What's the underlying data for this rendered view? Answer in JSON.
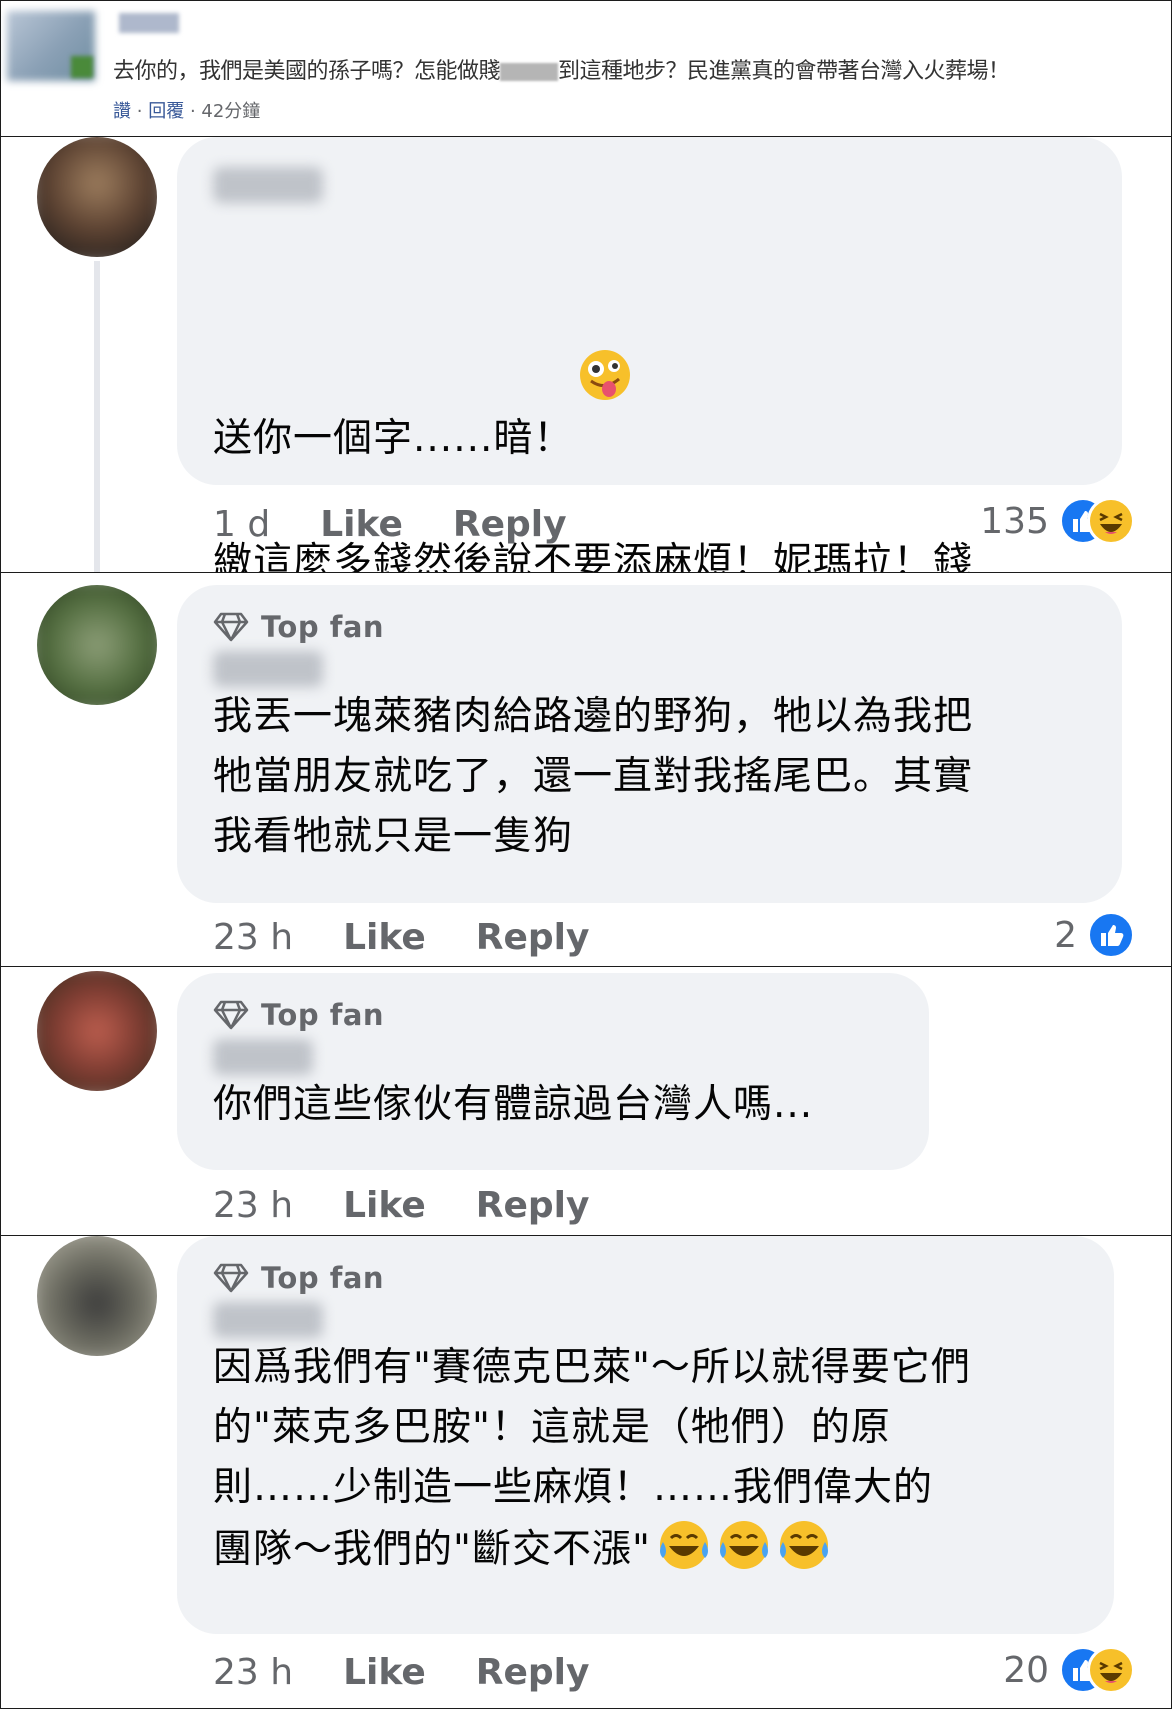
{
  "snippet": {
    "text_before": "去你的，我們是美國的孫子嗎？怎能做賤",
    "text_after": "到這種地步？民進黨真的會帶著台灣入火葬場！",
    "meta_report": "讚",
    "meta_sep": "·",
    "meta_reply": "回覆",
    "meta_time": "· 42分鐘"
  },
  "comments": [
    {
      "top_fan": "",
      "line1": "送你一個字......暗！",
      "body": "繳這麼多錢然後說不要添麻煩！妮瑪拉！錢\n丟水裡還會冬一聲！",
      "time": "1 d",
      "like": "Like",
      "reply": "Reply",
      "reaction_count": "135",
      "reactions": [
        "like-icon",
        "haha-icon"
      ],
      "emoji": "zany-face-icon"
    },
    {
      "top_fan": "Top fan",
      "body": "我丟一塊萊豬肉給路邊的野狗，牠以為我把\n牠當朋友就吃了，還一直對我搖尾巴。其實\n我看牠就只是一隻狗",
      "time": "23 h",
      "like": "Like",
      "reply": "Reply",
      "reaction_count": "2",
      "reactions": [
        "like-icon"
      ]
    },
    {
      "top_fan": "Top fan",
      "body": "你們這些傢伙有體諒過台灣人嗎...",
      "time": "23 h",
      "like": "Like",
      "reply": "Reply",
      "reaction_count": "",
      "reactions": []
    },
    {
      "top_fan": "Top fan",
      "body": "因爲我們有\"賽德克巴萊\"～所以就得要它們\n的\"萊克多巴胺\"！這就是（牠們）的原\n則……少制造一些麻煩！……我們偉大的\n團隊～我們的\"斷交不漲\"",
      "time": "23 h",
      "like": "Like",
      "reply": "Reply",
      "reaction_count": "20",
      "reactions": [
        "like-icon",
        "haha-icon"
      ],
      "emoji": "tears-of-joy-icon"
    }
  ],
  "colors": {
    "like_blue": "#1877f2",
    "haha_yellow": "#f7c02a",
    "bubble_bg": "#f0f2f5",
    "meta_gray": "#65676b"
  }
}
